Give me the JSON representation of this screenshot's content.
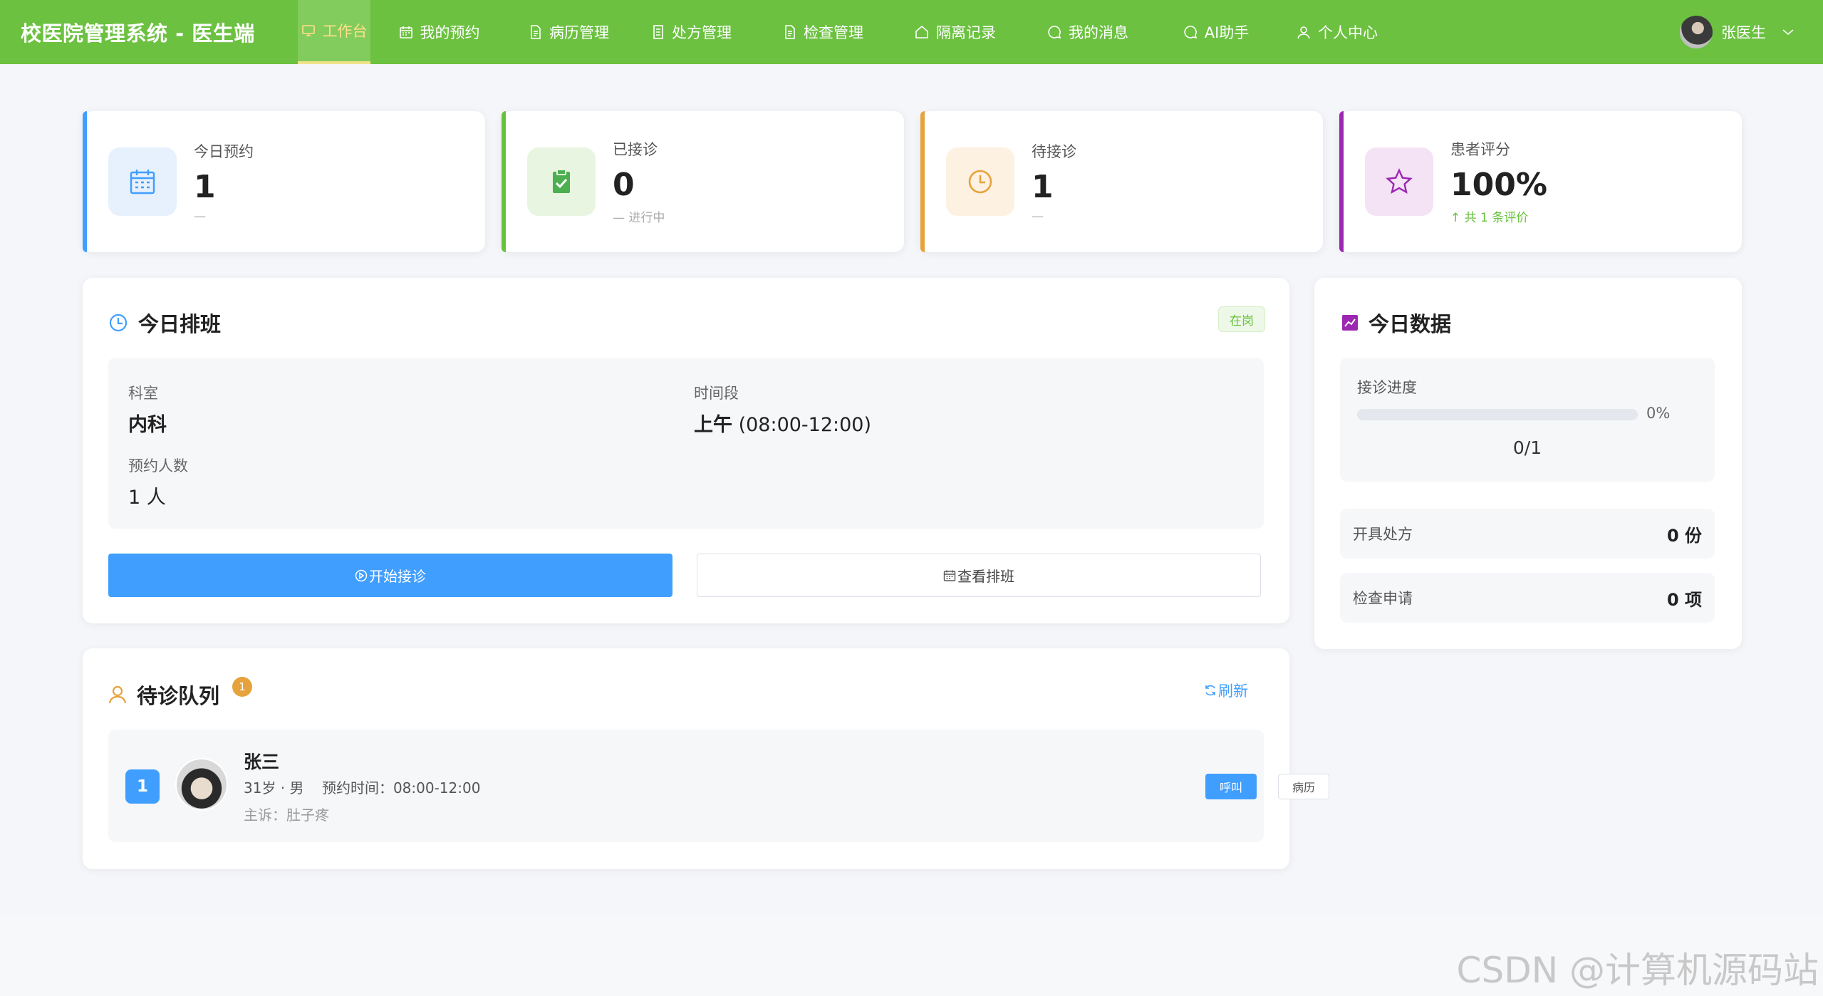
{
  "header": {
    "brand": "校医院管理系统 - 医生端",
    "bg_color": "#6cc141",
    "nav": [
      {
        "label": "工作台",
        "icon": "monitor-icon",
        "active": true
      },
      {
        "label": "我的预约",
        "icon": "calendar-icon",
        "active": false
      },
      {
        "label": "病历管理",
        "icon": "document-icon",
        "active": false
      },
      {
        "label": "处方管理",
        "icon": "document-icon",
        "active": false
      },
      {
        "label": "检查管理",
        "icon": "document-icon",
        "active": false
      },
      {
        "label": "隔离记录",
        "icon": "home-icon",
        "active": false
      },
      {
        "label": "我的消息",
        "icon": "chat-icon",
        "active": false
      },
      {
        "label": "AI助手",
        "icon": "chat-icon",
        "active": false
      },
      {
        "label": "个人中心",
        "icon": "user-icon",
        "active": false
      }
    ],
    "user_name": "张医生"
  },
  "stats": [
    {
      "label": "今日预约",
      "value": "1",
      "sub": "—",
      "color": "#409eff",
      "icon": "calendar-icon"
    },
    {
      "label": "已接诊",
      "value": "0",
      "sub": "— 进行中",
      "color": "#67c23a",
      "icon": "clipboard-check-icon"
    },
    {
      "label": "待接诊",
      "value": "1",
      "sub": "—",
      "color": "#e6a23c",
      "icon": "clock-icon"
    },
    {
      "label": "患者评分",
      "value": "100%",
      "sub": "↑ 共 1 条评价",
      "color": "#9c27b0",
      "icon": "star-icon"
    }
  ],
  "schedule": {
    "title": "今日排班",
    "status_tag": "在岗",
    "dept_label": "科室",
    "dept_value": "内科",
    "time_label": "时间段",
    "time_value_bold": "上午",
    "time_value_rest": "(08:00-12:00)",
    "count_label": "预约人数",
    "count_value": "1 人",
    "start_btn": "开始接诊",
    "view_btn": "查看排班"
  },
  "today_data": {
    "title": "今日数据",
    "progress_label": "接诊进度",
    "progress_fraction": 0,
    "progress_pct": "0%",
    "progress_ratio": "0/1",
    "rx_label": "开具处方",
    "rx_value": "0 份",
    "exam_label": "检查申请",
    "exam_value": "0 项"
  },
  "queue": {
    "title": "待诊队列",
    "badge": "1",
    "refresh": "刷新",
    "patients": [
      {
        "no": "1",
        "name": "张三",
        "info": "31岁 · 男    预约时间：08:00-12:00",
        "complaint": "主诉：肚子疼",
        "call_btn": "呼叫",
        "record_btn": "病历"
      }
    ]
  },
  "watermark": "CSDN @计算机源码站"
}
